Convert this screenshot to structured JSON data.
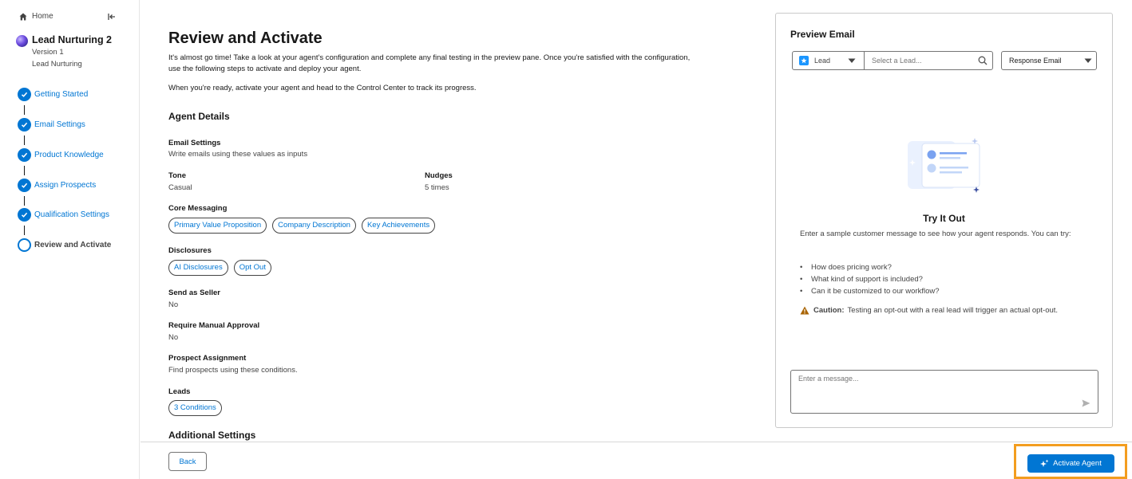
{
  "sidebar": {
    "home_label": "Home",
    "agent": {
      "name": "Lead Nurturing 2",
      "version": "Version 1",
      "type": "Lead Nurturing"
    },
    "steps": [
      {
        "label": "Getting Started",
        "status": "complete"
      },
      {
        "label": "Email Settings",
        "status": "complete"
      },
      {
        "label": "Product Knowledge",
        "status": "complete"
      },
      {
        "label": "Assign Prospects",
        "status": "complete"
      },
      {
        "label": "Qualification Settings",
        "status": "complete"
      },
      {
        "label": "Review and Activate",
        "status": "current"
      }
    ]
  },
  "main": {
    "title": "Review and Activate",
    "intro": "It's almost go time! Take a look at your agent's configuration and complete any final testing in the preview pane. Once you're satisfied with the configuration, use the following steps to activate and deploy your agent.",
    "intro2": "When you're ready, activate your agent and head to the Control Center to track its progress.",
    "agent_details": {
      "heading": "Agent Details",
      "email_settings_label": "Email Settings",
      "email_settings_desc": "Write emails using these values as inputs",
      "tone_label": "Tone",
      "tone_value": "Casual",
      "nudges_label": "Nudges",
      "nudges_value": "5 times",
      "core_messaging_label": "Core Messaging",
      "core_messaging_pills": [
        "Primary Value Proposition",
        "Company Description",
        "Key Achievements"
      ],
      "disclosures_label": "Disclosures",
      "disclosures_pills": [
        "AI Disclosures",
        "Opt Out"
      ],
      "send_as_seller_label": "Send as Seller",
      "send_as_seller_value": "No",
      "manual_approval_label": "Require Manual Approval",
      "manual_approval_value": "No",
      "prospect_assignment_label": "Prospect Assignment",
      "prospect_assignment_desc": "Find prospects using these conditions.",
      "leads_label": "Leads",
      "leads_pill": "3 Conditions"
    },
    "additional_heading": "Additional Settings"
  },
  "footer": {
    "back_label": "Back",
    "activate_label": "Activate Agent"
  },
  "preview": {
    "title": "Preview Email",
    "object_select": "Lead",
    "search_placeholder": "Select a Lead...",
    "response_select": "Response Email",
    "try_title": "Try It Out",
    "try_desc": "Enter a sample customer message to see how your agent responds. You can try:",
    "suggestions": [
      "How does pricing work?",
      "What kind of support is included?",
      "Can it be customized to our workflow?"
    ],
    "caution_label": "Caution:",
    "caution_text": "Testing an opt-out with a real lead will trigger an actual opt-out.",
    "message_placeholder": "Enter a message..."
  },
  "colors": {
    "brand": "#0176d3",
    "highlight": "#f39d1f",
    "warning": "#a96404"
  }
}
